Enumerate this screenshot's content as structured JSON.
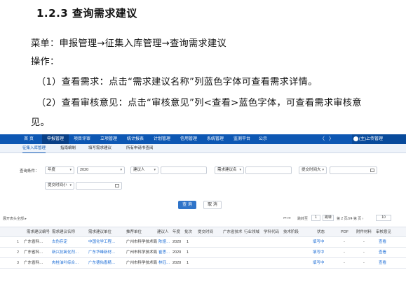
{
  "doc": {
    "heading": "1.2.3 查询需求建议",
    "menu_line": "菜单：申报管理→征集入库管理→查询需求建议",
    "steps_label": "操作：",
    "step1": "（1）查看需求：点击“需求建议名称”列蓝色字体可查看需求详情。",
    "step2_part1": "（2）查看审核意见：点击“审核意见”列<查看>蓝色字体，可查看需求审核意",
    "step2_part2": "见。"
  },
  "screenshot": {
    "nav": [
      "首 页",
      "申报管理",
      "项目评审",
      "立项管理",
      "统计报表",
      "计划管理",
      "信用管理",
      "系统管理",
      "监测平台",
      "公示"
    ],
    "nav_active_index": 1,
    "nav_arrows": [
      "〈",
      "〉"
    ],
    "user_label": "(主)上传管理",
    "subtabs": [
      "征集入库管理",
      "指南编制",
      "填写需求建议",
      "所有申请书查阅"
    ],
    "filters": {
      "label": "查询条件：",
      "year_select": "年度",
      "year_value": "2020",
      "proposer_select": "建议人",
      "name_select": "需求建议名",
      "submit_time_select": "提交时间大",
      "submit_time_small": "提交时间小"
    },
    "buttons": {
      "search": "查 询",
      "reset": "取 消"
    },
    "toolbar": {
      "left_text": "展开表头全部 ▸",
      "page_label": "跳转至",
      "page_value": "1",
      "goto": "跳转",
      "total_text": "第 2 页/24 第 页 ›",
      "page_size": "10"
    },
    "table": {
      "headers": [
        "需求建议编号",
        "需求建议名称",
        "需求建议单位",
        "推荐单位",
        "建议人",
        "年度",
        "批次",
        "提交时间",
        "广东省技术",
        "行业领域",
        "学科代码",
        "技术阶段",
        "状态",
        "PDF",
        "附件材料",
        "审核意见"
      ],
      "rows": [
        [
          "1",
          "广东省科…",
          "去伪存定",
          "中国化学工程…",
          "广州市科学技术局",
          "陈煜…",
          "2020",
          "1",
          "",
          "",
          "",
          "",
          "",
          "填写中",
          "-",
          "-",
          "查看"
        ],
        [
          "2",
          "广东省科…",
          "新兴抗氧化剂…",
          "广东华峰新材…",
          "广州市科学技术局",
          "崔思…",
          "2020",
          "1",
          "",
          "",
          "",
          "",
          "",
          "填写中",
          "-",
          "-",
          "查看"
        ],
        [
          "3",
          "广东省科…",
          "肉桂油叶综合…",
          "广东德佑香精…",
          "广州市科学技术局",
          "林钰…",
          "2020",
          "1",
          "",
          "",
          "",
          "",
          "",
          "填写中",
          "-",
          "-",
          "查看"
        ]
      ]
    }
  }
}
